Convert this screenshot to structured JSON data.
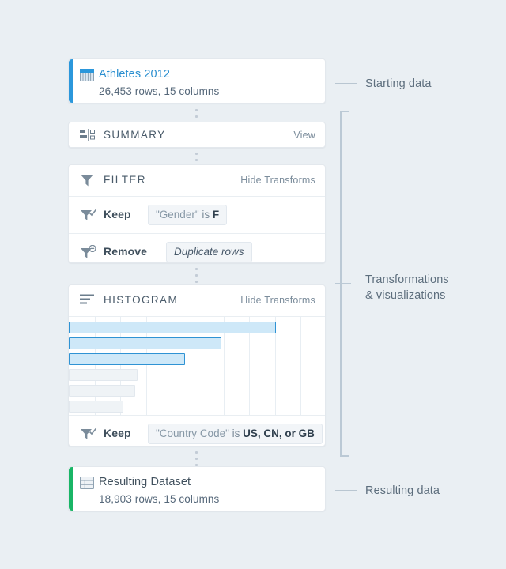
{
  "theme": {
    "background": "#eaeff3",
    "card_bg": "#ffffff",
    "accent_blue": "#2b97db",
    "accent_green": "#19b566",
    "bar_fill": "#cee8f8",
    "bar_stroke": "#2f93d4",
    "bar_dim_fill": "#eff3f6",
    "text_dark": "#41515e",
    "text_muted": "#7c8d9c"
  },
  "starting_dataset": {
    "icon": "table-icon",
    "title": "Athletes 2012",
    "subtitle": "26,453 rows, 15 columns",
    "rows": "26,453",
    "columns": "15"
  },
  "summary_step": {
    "icon": "summary-icon",
    "title": "SUMMARY",
    "action": "View"
  },
  "filter_step": {
    "icon": "filter-icon",
    "title": "FILTER",
    "action": "Hide Transforms",
    "rows": [
      {
        "icon": "filter-check-icon",
        "verb": "Keep",
        "pill": {
          "field": "\"Gender\"",
          "op": "is",
          "value": "F",
          "italic": false
        }
      },
      {
        "icon": "filter-minus-icon",
        "verb": "Remove",
        "pill": {
          "field": "",
          "op": "",
          "value": "Duplicate rows",
          "italic": true
        }
      }
    ]
  },
  "histogram_step": {
    "icon": "histogram-icon",
    "title": "HISTOGRAM",
    "action": "Hide Transforms",
    "row": {
      "icon": "filter-check-icon",
      "verb": "Keep",
      "pill": {
        "field": "\"Country Code\"",
        "op": "is",
        "value": "US, CN, or GB",
        "italic": false
      }
    }
  },
  "chart_data": {
    "type": "bar",
    "orientation": "horizontal",
    "title": "HISTOGRAM",
    "xlabel": "",
    "ylabel": "",
    "grid": true,
    "gridline_count": 9,
    "xlim": [
      0,
      100
    ],
    "categories": [
      "bar-1",
      "bar-2",
      "bar-3",
      "bar-4",
      "bar-5",
      "bar-6"
    ],
    "values": [
      84,
      62,
      47,
      28,
      27,
      22
    ],
    "series": [
      {
        "name": "selected",
        "values": [
          84,
          62,
          47,
          null,
          null,
          null
        ]
      },
      {
        "name": "unselected",
        "values": [
          null,
          null,
          null,
          28,
          27,
          22
        ]
      }
    ],
    "legend": []
  },
  "resulting_dataset": {
    "icon": "table-icon",
    "title": "Resulting Dataset",
    "subtitle": "18,903 rows, 15 columns",
    "rows": "18,903",
    "columns": "15"
  },
  "annotations": {
    "starting": "Starting data",
    "transformations_line1": "Transformations",
    "transformations_line2": "& visualizations",
    "resulting": "Resulting data"
  }
}
